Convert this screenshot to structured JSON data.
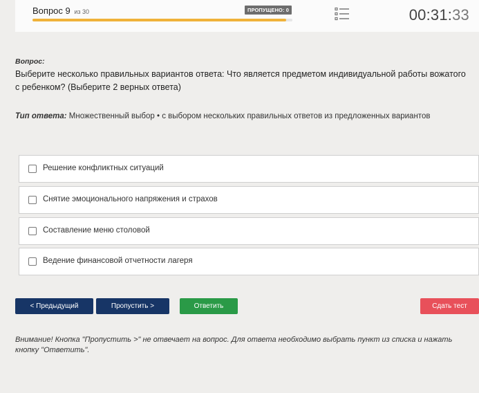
{
  "header": {
    "question_label": "Вопрос 9",
    "question_of": "из 30",
    "skipped_badge": "ПРОПУЩЕНО: 0",
    "progress_fraction": 0.975,
    "timer_main": "00:31:",
    "timer_seconds": "33"
  },
  "question": {
    "label": "Вопрос:",
    "text": "Выберите несколько правильных вариантов ответа: Что является предметом индивидуальной работы вожатого с ребенком? (Выберите 2 верных ответа)"
  },
  "answer_type": {
    "label": "Тип ответа:",
    "value": "Множественный выбор • с выбором нескольких правильных ответов из предложенных вариантов"
  },
  "options": [
    {
      "label": "Решение конфликтных ситуаций"
    },
    {
      "label": "Снятие эмоционального напряжения и страхов"
    },
    {
      "label": "Составление меню столовой"
    },
    {
      "label": "Ведение финансовой отчетности лагеря"
    }
  ],
  "buttons": {
    "prev": "< Предыдущий",
    "skip": "Пропустить >",
    "answer": "Ответить",
    "finish": "Сдать тест"
  },
  "notice": "Внимание! Кнопка \"Пропустить >\" не отвечает на вопрос. Для ответа необходимо выбрать пункт из списка и нажать кнопку \"Ответить\".",
  "colors": {
    "primary": "#173566",
    "success": "#2a9a47",
    "danger": "#e8505a",
    "progress": "#f0b23a"
  }
}
